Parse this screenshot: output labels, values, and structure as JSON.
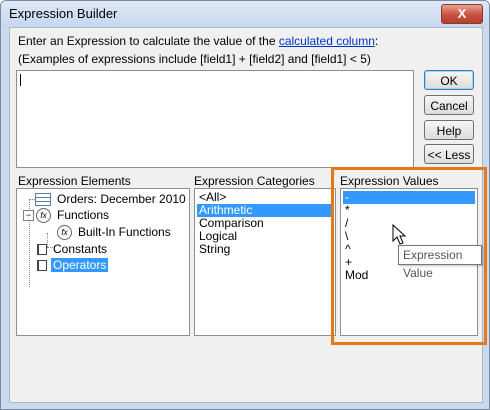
{
  "window": {
    "title": "Expression Builder",
    "close_symbol": "X"
  },
  "prompt": {
    "text_before": "Enter an Expression to calculate the value of the ",
    "link": "calculated column",
    "text_after": ":"
  },
  "examples": "(Examples of expressions include [field1] + [field2] and [field1] < 5)",
  "buttons": {
    "ok": "OK",
    "cancel": "Cancel",
    "help": "Help",
    "less": "<< Less"
  },
  "elements": {
    "label": "Expression Elements",
    "items": [
      {
        "label": "Orders: December 2010",
        "icon": "table-icon"
      },
      {
        "label": "Functions",
        "icon": "function-icon"
      },
      {
        "label": "Built-In Functions",
        "icon": "function-icon"
      },
      {
        "label": "Constants",
        "icon": "node-icon"
      },
      {
        "label": "Operators",
        "icon": "node-icon",
        "selected": true
      }
    ]
  },
  "categories": {
    "label": "Expression Categories",
    "items": [
      "<All>",
      "Arithmetic",
      "Comparison",
      "Logical",
      "String"
    ],
    "selected": "Arithmetic"
  },
  "values": {
    "label": "Expression Values",
    "items": [
      "-",
      "*",
      "/",
      "\\",
      "^",
      "+",
      "Mod"
    ],
    "selected": "-"
  },
  "tooltip": "Expression Value",
  "accent_color": "#e67817",
  "selection_color": "#3399ff"
}
